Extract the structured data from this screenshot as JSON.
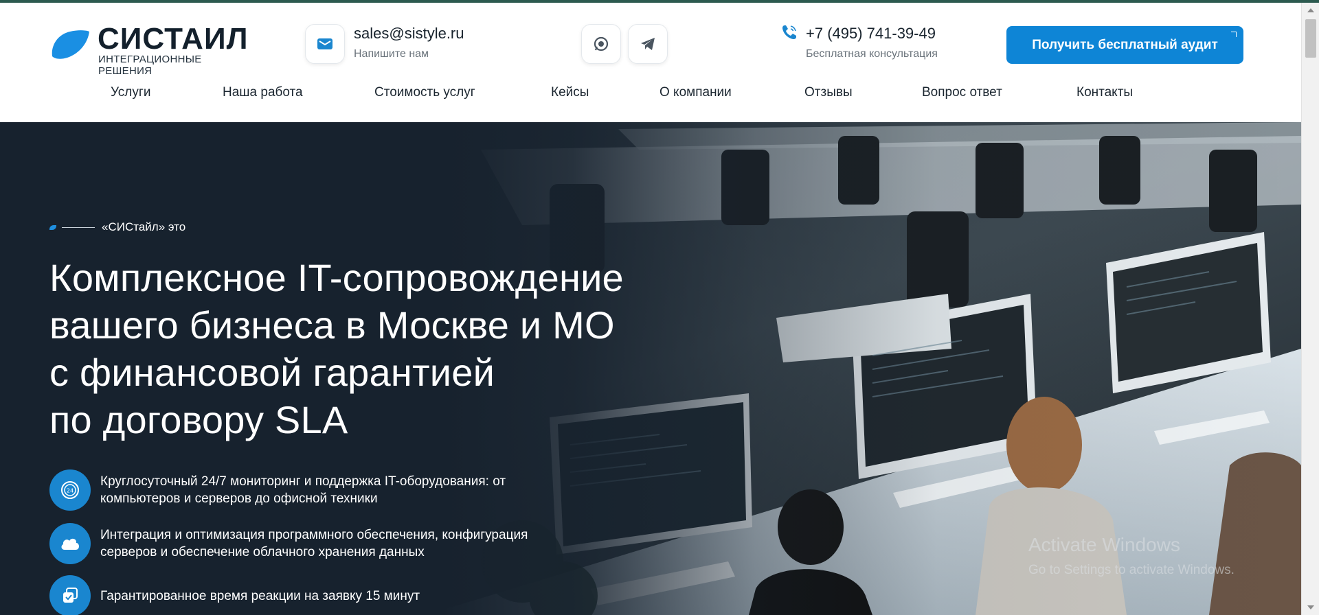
{
  "brand": {
    "name": "СИСТАИЛ",
    "tagline": "ИНТЕГРАЦИОННЫЕ РЕШЕНИЯ",
    "accent_color": "#0e85d6",
    "dark_color": "#17222e"
  },
  "contacts": {
    "email": "sales@sistyle.ru",
    "email_note": "Напишите нам",
    "phone": "+7 (495) 741-39-49",
    "phone_note": "Бесплатная консультация",
    "icons": [
      "mail-icon",
      "whatsapp-icon",
      "telegram-icon",
      "phone-icon"
    ]
  },
  "cta": {
    "label": "Получить бесплатный аудит"
  },
  "nav": {
    "items": [
      {
        "label": "Услуги"
      },
      {
        "label": "Наша работа"
      },
      {
        "label": "Стоимость услуг"
      },
      {
        "label": "Кейсы"
      },
      {
        "label": "О компании"
      },
      {
        "label": "Отзывы"
      },
      {
        "label": "Вопрос ответ"
      },
      {
        "label": "Контакты"
      }
    ]
  },
  "hero": {
    "eyebrow": "«СИСтайл» это",
    "headline_lines": [
      "Комплексное IT-сопровождение",
      "вашего бизнеса в Москве и МО",
      "с финансовой гарантией",
      "по договору SLA"
    ],
    "features": [
      {
        "icon": "clock-24-icon",
        "text": "Круглосуточный 24/7 мониторинг и поддержка IT-оборудования: от компьютеров и серверов до офисной техники"
      },
      {
        "icon": "cloud-icon",
        "text": "Интеграция и оптимизация программного обеспечения, конфигурация серверов и обеспечение облачного хранения данных"
      },
      {
        "icon": "copy-check-icon",
        "text": "Гарантированное время реакции на заявку 15 минут"
      }
    ]
  },
  "watermark": {
    "title": "Activate Windows",
    "subtitle": "Go to Settings to activate Windows."
  }
}
